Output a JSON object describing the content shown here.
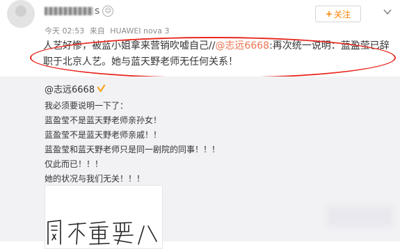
{
  "header": {
    "username_suffix": "s",
    "follow_label": "关注",
    "follow_plus": "+",
    "timestamp": "今天 02:53",
    "source_prefix": "来自",
    "source_device": "HUAWEI nova 3"
  },
  "post": {
    "text_before": "人艺好惨，被蓝小姐拿来营销吹嘘自己//",
    "mention": "@志远6668",
    "text_after": ":再次统一说明：蓝盈莹已辞职于北京人艺。她与蓝天野老师无任何关系！"
  },
  "repost": {
    "author": "@志远6668",
    "lines": [
      "我必须要说明一下了：",
      "蓝盈莹不是蓝天野老师亲孙女！",
      "蓝盈莹不是蓝天野老师亲戚！！",
      "蓝盈莹和蓝天野老师只是同一剧院的同事！！！",
      "仅此而已！！！",
      "她的状况与我们无关！！！"
    ],
    "image_text": "圆不重要八"
  },
  "colors": {
    "follow_orange": "#ff8200",
    "mention_orange": "#eb7350",
    "annotation_red": "#e8271e",
    "verified_gold": "#f5a623",
    "repost_bg": "#f2f2f5"
  },
  "icons": [
    "avatar",
    "level-icon",
    "chevron-down-icon",
    "verified-icon"
  ]
}
